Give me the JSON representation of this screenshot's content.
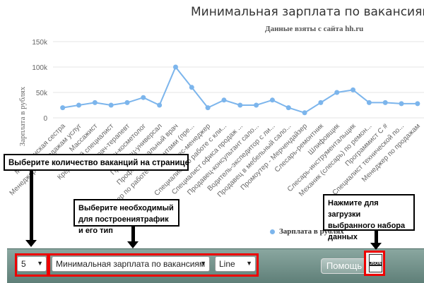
{
  "chart": {
    "title": "Минимальная зарплата по вакансиям",
    "subtitle": "Данные взяты с сайта hh.ru",
    "yaxis_title": "Зарплата в рублях",
    "legend_label": "Зарплата в рублях"
  },
  "chart_data": {
    "type": "line",
    "title": "Минимальная зарплата по вакансиям",
    "subtitle": "Данные взяты с сайта hh.ru",
    "ylabel": "Зарплата в рублях",
    "ylim": [
      0,
      150000
    ],
    "yticks": [
      "0",
      "50k",
      "100k",
      "150k"
    ],
    "grid": true,
    "legend": "bottom",
    "series_color": "#7cb5ec",
    "categories": [
      "Медицинская сестра",
      "Менеджер по продажам услуг",
      "Массажист",
      "Кредитный специалист",
      "Врач-терапевт",
      "Врач-косметолог",
      "Продавец-универсал",
      "Профессиональный врач",
      "Менеджер по работе с клиентами (пре...",
      "Бизнес-менеджер",
      "Специалист по работе с кли...",
      "Специалист офиса продаж ...",
      "Продавец-консультант сало...",
      "Водитель-экспедитор с ли...",
      "Продавец в мебельный сало...",
      "Промоутер - Мерчендайзер",
      "Слесарь-ремонтник",
      "Шлифовщик",
      "Слесарь-инструментальщик",
      "Механик (слесарь) по ремон...",
      "Программист С #",
      "Специалист технической по...",
      "Менеджер по продажам"
    ],
    "series": [
      {
        "name": "Зарплата в рублях",
        "values": [
          20000,
          25000,
          30000,
          25000,
          30000,
          40000,
          25000,
          100000,
          60000,
          20000,
          35000,
          25000,
          25000,
          35000,
          20000,
          10000,
          30000,
          50000,
          55000,
          30000,
          30000,
          28000,
          28000
        ]
      }
    ]
  },
  "toolbar": {
    "count_value": "5",
    "chart_select_value": "Минимальная зарплата по вакансиям",
    "type_select_value": "Line",
    "help_label": "Помощь",
    "json_label": "JSON"
  },
  "annotations": {
    "count": "Выберите количество ваканций на странице",
    "chart": "Выберите необходимый для построениятрафик и его тип",
    "json": "Нажмите для загрузки выбранного набора данных"
  },
  "colors": {
    "toolbar_bg": "#6f8f88",
    "highlight": "#e00000",
    "line": "#7cb5ec"
  }
}
